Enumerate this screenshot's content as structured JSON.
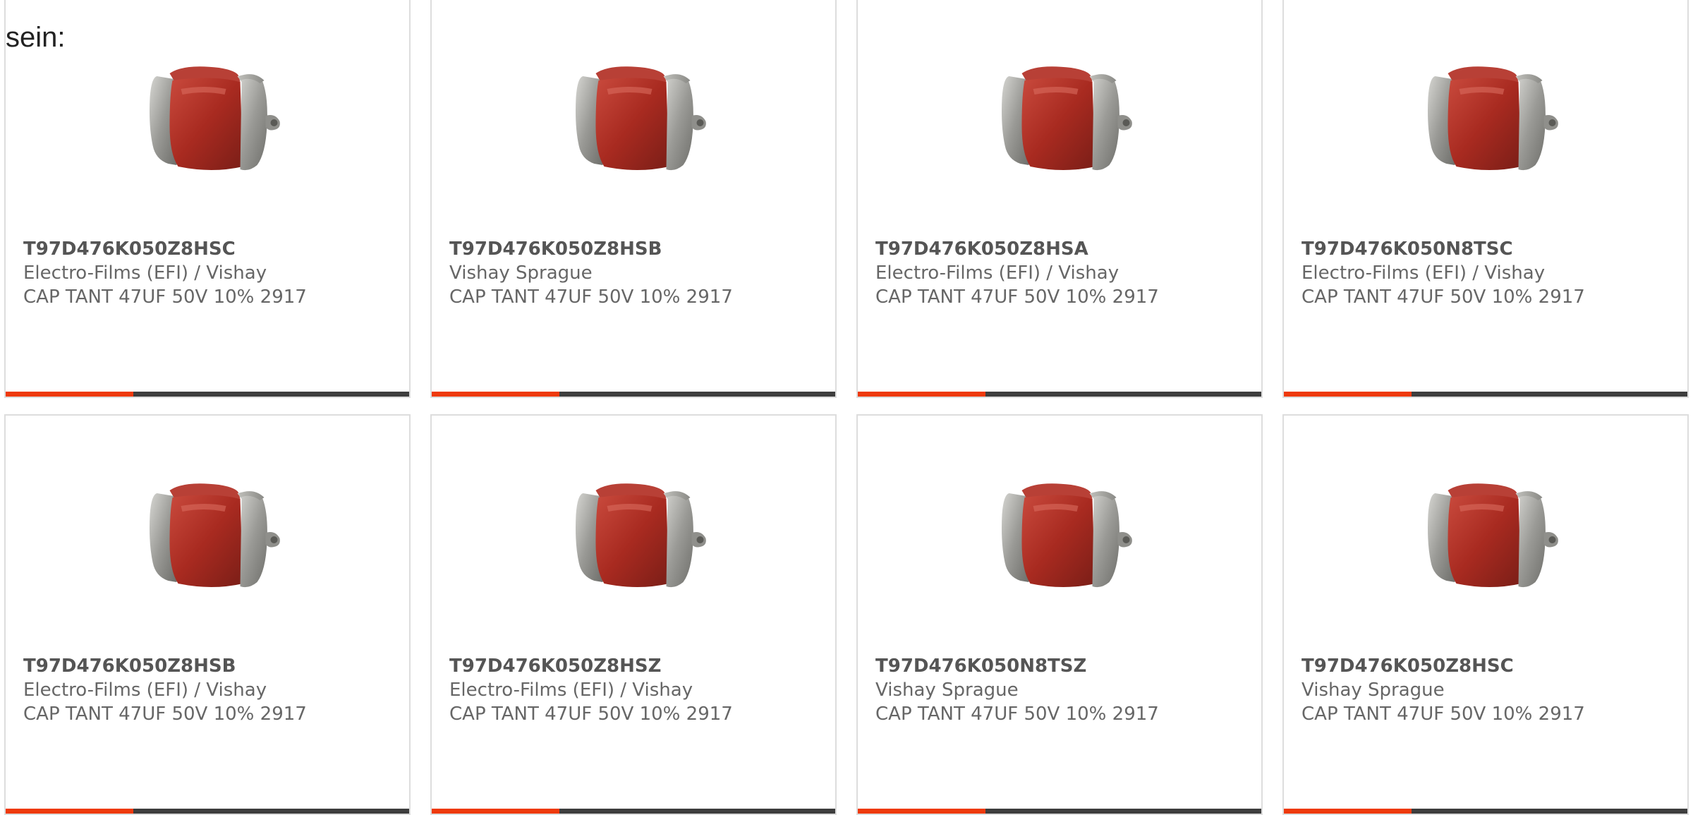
{
  "intro_text": "sein:",
  "colors": {
    "accent": "#ee3a0c",
    "bar": "#3e3e3e",
    "part_number": "#555555",
    "text": "#666666",
    "border": "#dddddd"
  },
  "icons": {
    "product_image": "tantalum-capacitor-image"
  },
  "products": [
    {
      "part_number": "T97D476K050Z8HSC",
      "manufacturer": "Electro-Films (EFI) / Vishay",
      "description": "CAP TANT 47UF 50V 10% 2917"
    },
    {
      "part_number": "T97D476K050Z8HSB",
      "manufacturer": "Vishay Sprague",
      "description": "CAP TANT 47UF 50V 10% 2917"
    },
    {
      "part_number": "T97D476K050Z8HSA",
      "manufacturer": "Electro-Films (EFI) / Vishay",
      "description": "CAP TANT 47UF 50V 10% 2917"
    },
    {
      "part_number": "T97D476K050N8TSC",
      "manufacturer": "Electro-Films (EFI) / Vishay",
      "description": "CAP TANT 47UF 50V 10% 2917"
    },
    {
      "part_number": "T97D476K050Z8HSB",
      "manufacturer": "Electro-Films (EFI) / Vishay",
      "description": "CAP TANT 47UF 50V 10% 2917"
    },
    {
      "part_number": "T97D476K050Z8HSZ",
      "manufacturer": "Electro-Films (EFI) / Vishay",
      "description": "CAP TANT 47UF 50V 10% 2917"
    },
    {
      "part_number": "T97D476K050N8TSZ",
      "manufacturer": "Vishay Sprague",
      "description": "CAP TANT 47UF 50V 10% 2917"
    },
    {
      "part_number": "T97D476K050Z8HSC",
      "manufacturer": "Vishay Sprague",
      "description": "CAP TANT 47UF 50V 10% 2917"
    }
  ]
}
